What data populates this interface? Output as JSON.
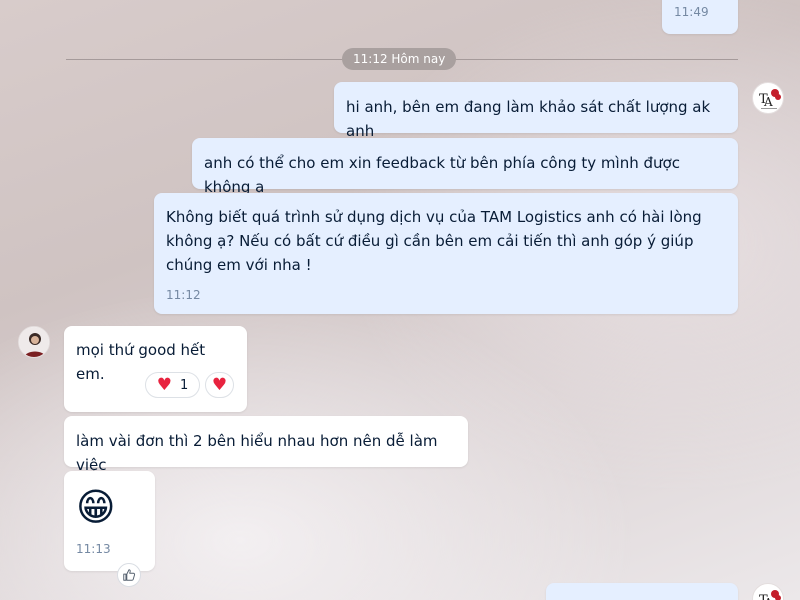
{
  "messages": {
    "top_partial": {
      "time": "11:49"
    },
    "divider": {
      "label": "11:12 Hôm nay"
    },
    "m1": {
      "text": "hi anh, bên em đang làm khảo sát chất lượng ak anh"
    },
    "m2": {
      "text": "anh có thể cho em xin feedback từ bên phía công ty mình được không ạ"
    },
    "m3": {
      "text": "Không biết quá trình sử dụng dịch vụ của TAM Logistics anh có hài lòng không ạ? Nếu có bất cứ điều gì cần bên em cải tiến thì anh góp ý giúp chúng em với nha !",
      "time": "11:12"
    },
    "r1": {
      "text": "mọi thứ good hết em.",
      "reaction_count": "1"
    },
    "r2": {
      "text": "làm vài đơn thì 2 bên hiểu nhau hơn nên dễ làm việc"
    },
    "r3": {
      "emoji": "😁",
      "time": "11:13"
    }
  },
  "icons": {
    "heart_icon": "♥",
    "like_icon": "thumbs-up"
  },
  "colors": {
    "my_bubble": "#e5efff",
    "their_bubble": "#ffffff",
    "text": "#081c36",
    "time": "#7589a3",
    "heart": "#e8233f"
  }
}
